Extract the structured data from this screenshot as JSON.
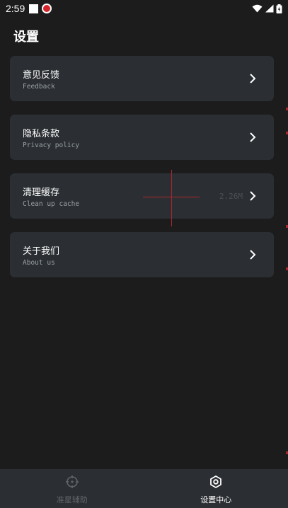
{
  "status_bar": {
    "time": "2:59"
  },
  "page": {
    "title": "设置"
  },
  "settings": [
    {
      "title": "意见反馈",
      "subtitle": "Feedback",
      "value": ""
    },
    {
      "title": "隐私条款",
      "subtitle": "Privacy policy",
      "value": ""
    },
    {
      "title": "清理缓存",
      "subtitle": "Clean up cache",
      "value": "2.26M"
    },
    {
      "title": "关于我们",
      "subtitle": "About us",
      "value": ""
    }
  ],
  "bottom_nav": [
    {
      "label": "准星辅助",
      "icon": "crosshair-icon",
      "active": false
    },
    {
      "label": "设置中心",
      "icon": "settings-ring-icon",
      "active": true
    }
  ],
  "colors": {
    "background": "#1c1c1c",
    "card": "#2b2f33",
    "subtitle": "#9aa0a4",
    "crosshair": "#a8262b"
  }
}
